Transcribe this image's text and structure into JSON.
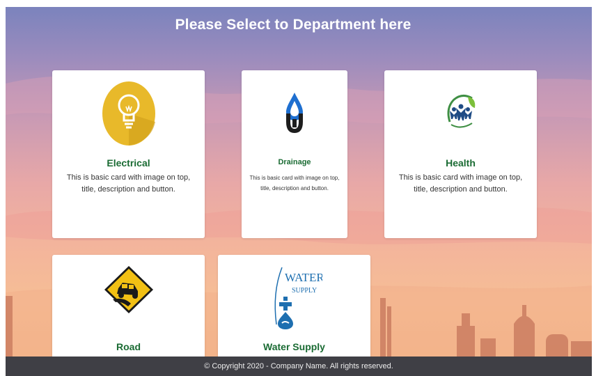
{
  "page": {
    "title": "Please Select to Department here"
  },
  "departments": [
    {
      "id": "electrical",
      "title": "Electrical",
      "description": "This is basic card with image on top, title, description and button.",
      "icon": "light-bulb-icon"
    },
    {
      "id": "drainage",
      "title": "Drainage",
      "description": "This is basic card with image on top, title, description and button.",
      "icon": "drainage-drop-icon"
    },
    {
      "id": "health",
      "title": "Health",
      "description": "This is basic card with image on top, title, description and button.",
      "icon": "health-people-icon"
    },
    {
      "id": "road",
      "title": "Road",
      "description": "",
      "icon": "road-warning-sign-icon"
    },
    {
      "id": "water",
      "title": "Water Supply",
      "description": "",
      "icon": "water-supply-icon",
      "logo_text": [
        "WATER",
        "SUPPLY"
      ]
    }
  ],
  "footer": {
    "text": "© Copyright 2020 - Company Name. All rights reserved."
  },
  "colors": {
    "card_title": "#1a6b33",
    "footer_bg": "#3f3f45",
    "bulb_yellow": "#e8b92a",
    "sky_top": "#7b83bd",
    "sky_bottom": "#f4b88a"
  }
}
